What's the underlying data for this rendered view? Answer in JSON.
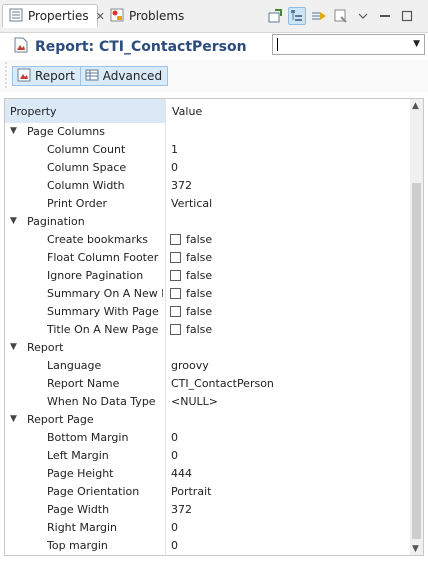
{
  "tabs": [
    {
      "label": "Properties",
      "icon": "properties-icon",
      "active": true
    },
    {
      "label": "Problems",
      "icon": "problems-icon",
      "active": false
    }
  ],
  "title": "Report: CTI_ContactPerson",
  "combo": {
    "value": ""
  },
  "sections": [
    {
      "label": "Report"
    },
    {
      "label": "Advanced"
    }
  ],
  "table": {
    "header": {
      "property": "Property",
      "value": "Value"
    },
    "categories": [
      {
        "label": "Page Columns",
        "items": [
          {
            "name": "Column Count",
            "value": "1"
          },
          {
            "name": "Column Space",
            "value": "0"
          },
          {
            "name": "Column Width",
            "value": "372"
          },
          {
            "name": "Print Order",
            "value": "Vertical"
          }
        ]
      },
      {
        "label": "Pagination",
        "items": [
          {
            "name": "Create bookmarks",
            "value": "false"
          },
          {
            "name": "Float Column Footer",
            "value": "false"
          },
          {
            "name": "Ignore Pagination",
            "value": "false"
          },
          {
            "name": "Summary On A New Page",
            "value": "false"
          },
          {
            "name": "Summary With Page Header",
            "value": "false"
          },
          {
            "name": "Title On A New Page",
            "value": "false"
          }
        ]
      },
      {
        "label": "Report",
        "items": [
          {
            "name": "Language",
            "value": "groovy"
          },
          {
            "name": "Report Name",
            "value": "CTI_ContactPerson"
          },
          {
            "name": "When No Data Type",
            "value": "<NULL>"
          }
        ]
      },
      {
        "label": "Report Page",
        "items": [
          {
            "name": "Bottom Margin",
            "value": "0"
          },
          {
            "name": "Left Margin",
            "value": "0"
          },
          {
            "name": "Page Height",
            "value": "444"
          },
          {
            "name": "Page Orientation",
            "value": "Portrait"
          },
          {
            "name": "Page Width",
            "value": "372"
          },
          {
            "name": "Right Margin",
            "value": "0"
          },
          {
            "name": "Top margin",
            "value": "0"
          }
        ]
      }
    ]
  },
  "colors": {
    "title": "#2b4c7e",
    "selection": "#dbe9f6",
    "sectionButtons": "#d9ebf9"
  }
}
